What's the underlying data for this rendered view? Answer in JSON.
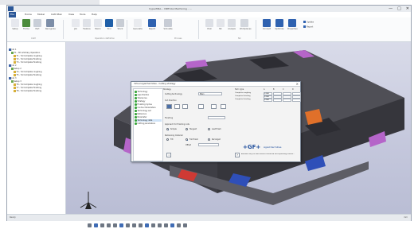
{
  "window": {
    "title": "hyperMILL - VIRTUAL Machining - ...",
    "controls": [
      "—",
      "□",
      "✕"
    ]
  },
  "menu": {
    "items": [
      "File",
      "Home",
      "Model",
      "CAM Plan",
      "View",
      "Tools",
      "Help"
    ]
  },
  "ribbon": {
    "buttons": [
      {
        "label": "Setup",
        "icon": "setup-icon",
        "color": "#e6e8ee"
      },
      {
        "label": "Frame",
        "icon": "frame-icon",
        "color": "#4b8b3b"
      },
      {
        "label": "Part",
        "icon": "part-icon",
        "color": "#c9cfd8"
      },
      {
        "label": "Recognize",
        "icon": "recognize-icon",
        "color": "#7d8ea8"
      },
      {
        "label": "Job",
        "icon": "job-icon",
        "color": "#e7e9ee"
      },
      {
        "label": "Feature",
        "icon": "feature-icon",
        "color": "#dfe2e8"
      },
      {
        "label": "Macro",
        "icon": "macro-icon",
        "color": "#e3e6ec"
      },
      {
        "label": "Tool",
        "icon": "tool-icon",
        "color": "#1f5fa8"
      },
      {
        "label": "Stock",
        "icon": "stock-icon",
        "color": "#c8cdd5"
      },
      {
        "label": "Generate",
        "icon": "generate-icon",
        "color": "#e9ebef"
      },
      {
        "label": "Report",
        "icon": "report-icon",
        "color": "#2f62b0"
      },
      {
        "label": "Simulate",
        "icon": "simulate-icon",
        "color": "#c7ccd5"
      },
      {
        "label": "Post",
        "icon": "post-icon",
        "color": "#dde0e6"
      },
      {
        "label": "NC",
        "icon": "nc-icon",
        "color": "#e3e5ea"
      },
      {
        "label": "Analyze",
        "icon": "analyze-icon",
        "color": "#dadde3"
      },
      {
        "label": "Workplanes",
        "icon": "workplanes-icon",
        "color": "#d3d7de"
      },
      {
        "label": "Connect",
        "icon": "connect-icon",
        "color": "#2f62b0"
      },
      {
        "label": "Optimize",
        "icon": "optimize-icon",
        "color": "#2f62b0"
      },
      {
        "label": "Properties",
        "icon": "properties-icon",
        "color": "#2f62b0"
      }
    ],
    "small_buttons": [
      "Update",
      "Report"
    ],
    "group_labels": [
      "CAM",
      "Operation definition",
      "Process",
      "NC"
    ]
  },
  "tree": {
    "rows": [
      {
        "text": "Job 1",
        "color": "#3a62a8"
      },
      {
        "text": "T1 - 3D Arbitrary Operation",
        "color": "#6aa84f"
      },
      {
        "text": "T1 - Tø Complete roughing",
        "color": "#d8b03a"
      },
      {
        "text": "T2 - Tø Complete finishing",
        "color": "#d8b03a"
      },
      {
        "text": "T3 - Tø Complete finishing",
        "color": "#d8b03a"
      },
      {
        "text": "Job 2",
        "color": "#3a62a8"
      },
      {
        "text": "Setup 2",
        "color": "#6aa84f"
      },
      {
        "text": "T4 - Tø Complete roughing",
        "color": "#d8b03a"
      },
      {
        "text": "T5 - Tø Complete finishing",
        "color": "#d8b03a"
      },
      {
        "text": "Job 3",
        "color": "#3a62a8"
      },
      {
        "text": "Setup 3",
        "color": "#6aa84f"
      },
      {
        "text": "T6 - Tø Complete roughing",
        "color": "#d8b03a"
      },
      {
        "text": "T7 - Tø Complete finishing",
        "color": "#d8b03a"
      },
      {
        "text": "T8 - Tø Complete finishing",
        "color": "#d8b03a"
      }
    ]
  },
  "dialog": {
    "title": "Virtual AgieCharmilles - Cutting strategy",
    "list": [
      "Technology",
      "Agie Position",
      "Tolerances",
      "Strategy",
      "Finishing Cycles",
      "Contour Parameters",
      "Technology set",
      "Reference",
      "Parameter",
      "Technology data",
      "Cutting parameters"
    ],
    "selected_index": 9,
    "main_labels": {
      "group": "Strategy",
      "field1": "Cutting technology",
      "field1_value": "Main",
      "cut_direction": "Cut direction",
      "finishing": "Finishing",
      "approach": "Approach for finishing cuts",
      "approach_opts": [
        "Simple",
        "Tangent",
        "Last finish"
      ],
      "approach_selected": 0,
      "remaining": "Remaining material",
      "remaining_opts": [
        "Tilt",
        "Full finish",
        "Ra target"
      ],
      "remaining_selected": 1,
      "offset_label": "Offset"
    },
    "table": {
      "headers": [
        "Tech. type",
        "A",
        "B",
        "C",
        "D"
      ],
      "rows": [
        {
          "name": "Complete roughing",
          "vals": [
            "0.040",
            "",
            "",
            ""
          ]
        },
        {
          "name": "Complete finishing",
          "vals": [
            "0.040",
            "",
            "",
            ""
          ]
        },
        {
          "name": "Complete finishing",
          "vals": [
            "0.040",
            "",
            "",
            ""
          ]
        }
      ]
    },
    "logo_text": "+GF+",
    "logo_sub": "AgieCharmilles",
    "footer_note": "Available only for data without formatted and separating contour...",
    "footer_icons": [
      "info-icon",
      "help-icon"
    ]
  },
  "status": {
    "left": "Ready",
    "right": "mm"
  }
}
